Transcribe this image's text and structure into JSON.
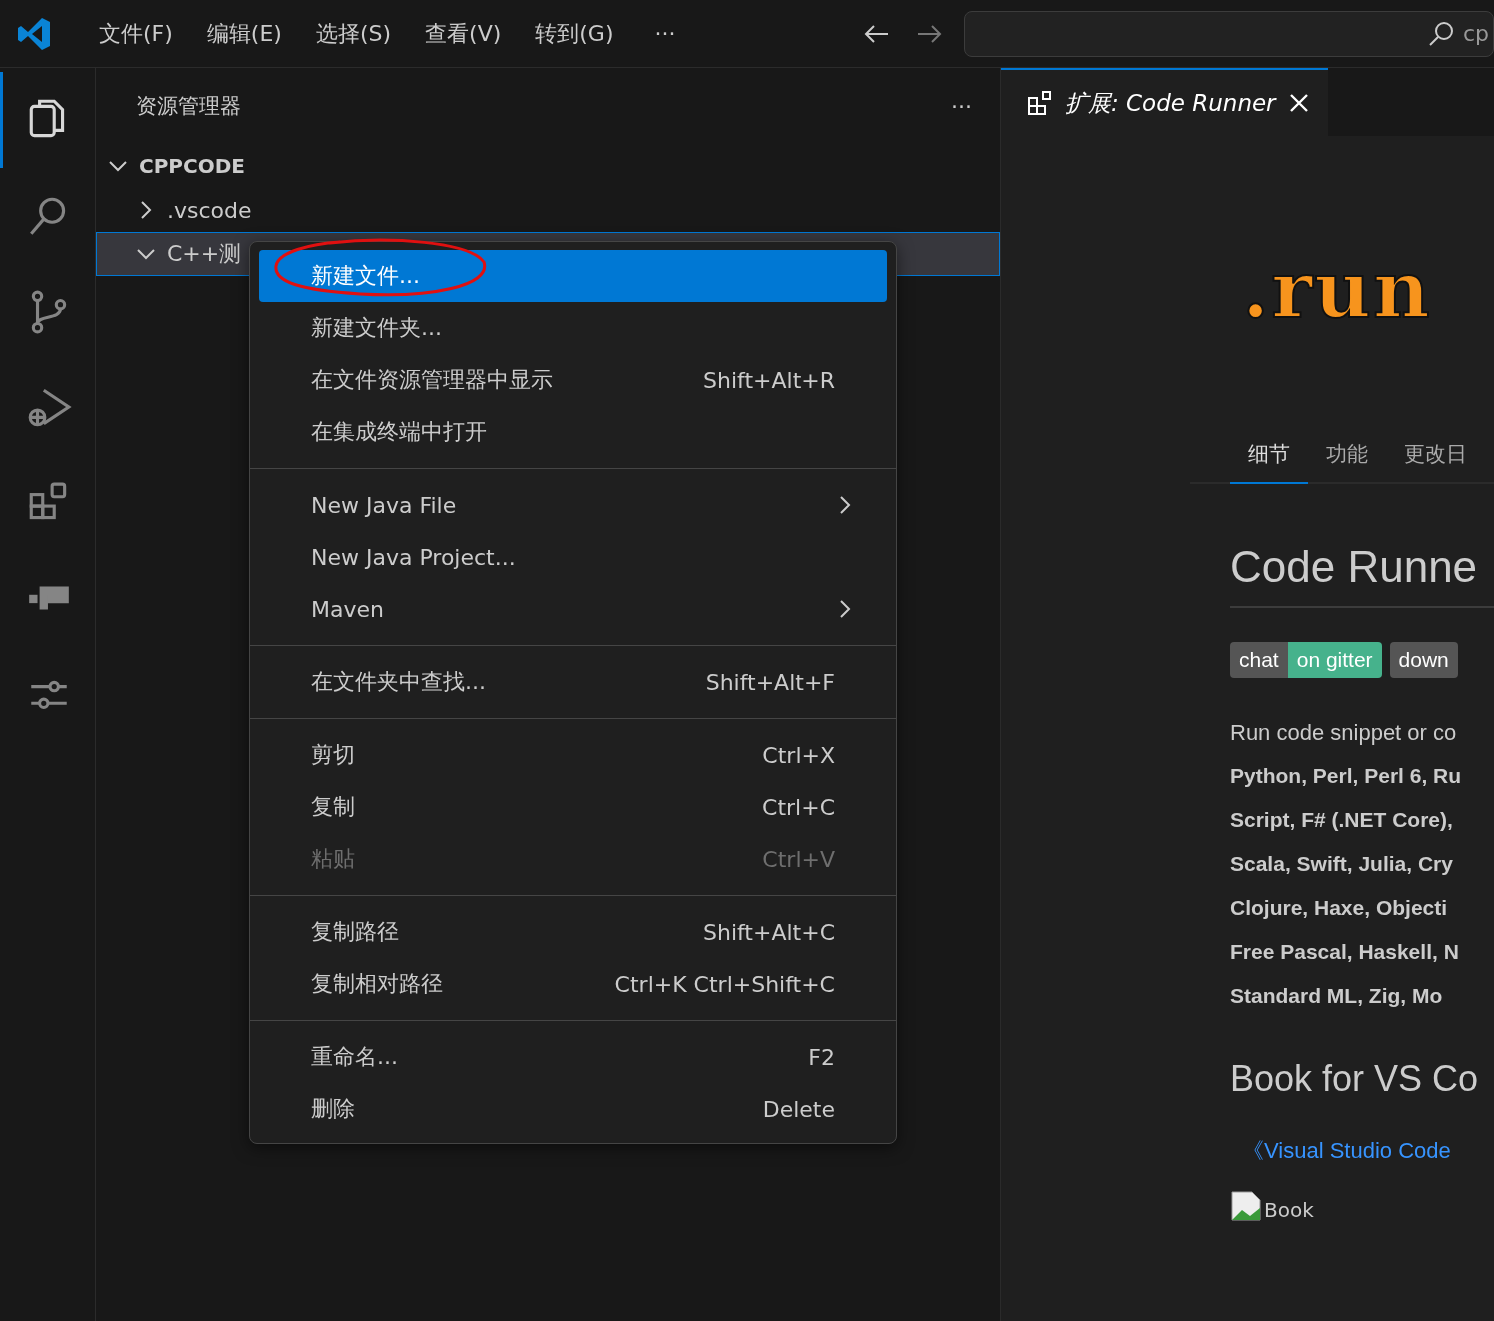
{
  "title_bar": {
    "menus": [
      "文件(F)",
      "编辑(E)",
      "选择(S)",
      "查看(V)",
      "转到(G)"
    ],
    "more": "···",
    "search": {
      "value": "cp"
    }
  },
  "activity_bar": [
    {
      "kind": "files",
      "selected": true
    },
    {
      "kind": "search",
      "selected": false
    },
    {
      "kind": "branch",
      "selected": false
    },
    {
      "kind": "debug",
      "selected": false
    },
    {
      "kind": "extensions",
      "selected": false
    },
    {
      "kind": "blocks",
      "selected": false
    },
    {
      "kind": "sliders",
      "selected": false
    }
  ],
  "sidebar": {
    "title": "资源管理器",
    "more": "···",
    "tree": [
      {
        "label": "CPPCODE",
        "expanded": true,
        "selected": false,
        "children": [
          {
            "label": ".vscode",
            "expanded": false,
            "selected": false
          },
          {
            "label": "C++测",
            "expanded": true,
            "selected": true
          }
        ]
      }
    ]
  },
  "context_menu": {
    "groups": [
      [
        {
          "label": "新建文件...",
          "selected": true,
          "disabled": false
        },
        {
          "label": "新建文件夹...",
          "selected": false,
          "disabled": false
        },
        {
          "label": "在文件资源管理器中显示",
          "shortcut": "Shift+Alt+R",
          "selected": false,
          "disabled": false
        },
        {
          "label": "在集成终端中打开",
          "selected": false,
          "disabled": false
        }
      ],
      [
        {
          "label": "New Java File",
          "submenu": true,
          "selected": false,
          "disabled": false
        },
        {
          "label": "New Java Project...",
          "selected": false,
          "disabled": false
        },
        {
          "label": "Maven",
          "submenu": true,
          "selected": false,
          "disabled": false
        }
      ],
      [
        {
          "label": "在文件夹中查找...",
          "shortcut": "Shift+Alt+F",
          "selected": false,
          "disabled": false
        }
      ],
      [
        {
          "label": "剪切",
          "shortcut": "Ctrl+X",
          "selected": false,
          "disabled": false
        },
        {
          "label": "复制",
          "shortcut": "Ctrl+C",
          "selected": false,
          "disabled": false
        },
        {
          "label": "粘贴",
          "shortcut": "Ctrl+V",
          "selected": false,
          "disabled": true
        }
      ],
      [
        {
          "label": "复制路径",
          "shortcut": "Shift+Alt+C",
          "selected": false,
          "disabled": false
        },
        {
          "label": "复制相对路径",
          "shortcut": "Ctrl+K Ctrl+Shift+C",
          "selected": false,
          "disabled": false
        }
      ],
      [
        {
          "label": "重命名...",
          "shortcut": "F2",
          "selected": false,
          "disabled": false
        },
        {
          "label": "删除",
          "shortcut": "Delete",
          "selected": false,
          "disabled": false
        }
      ]
    ]
  },
  "editor": {
    "tabs": [
      {
        "label": "扩展: Code Runner",
        "selected": true
      }
    ],
    "extension": {
      "logo": ".run",
      "nav": [
        {
          "label": "细节",
          "selected": true
        },
        {
          "label": "功能",
          "selected": false
        },
        {
          "label": "更改日",
          "selected": false
        }
      ],
      "name": "Code Runne",
      "badges": [
        {
          "parts": [
            {
              "text": "chat",
              "color": "#555555"
            },
            {
              "text": "on gitter",
              "color": "#46b28c"
            }
          ]
        },
        {
          "parts": [
            {
              "text": "down",
              "color": "#555555"
            }
          ]
        }
      ],
      "description": [
        {
          "text": "Run code snippet or co",
          "bold": false
        },
        {
          "text": "Python, Perl, Perl 6, Ru",
          "bold": true
        },
        {
          "text": "Script, F# (.NET Core),",
          "bold": true
        },
        {
          "text": "Scala, Swift, Julia, Cry",
          "bold": true
        },
        {
          "text": "Clojure, Haxe, Objecti",
          "bold": true
        },
        {
          "text": "Free Pascal, Haskell, N",
          "bold": true
        },
        {
          "text": "Standard ML, Zig, Mo",
          "bold": true
        }
      ],
      "section_title": "Book for VS Co",
      "book_link": "《Visual Studio Code",
      "image_alt": "Book"
    }
  }
}
